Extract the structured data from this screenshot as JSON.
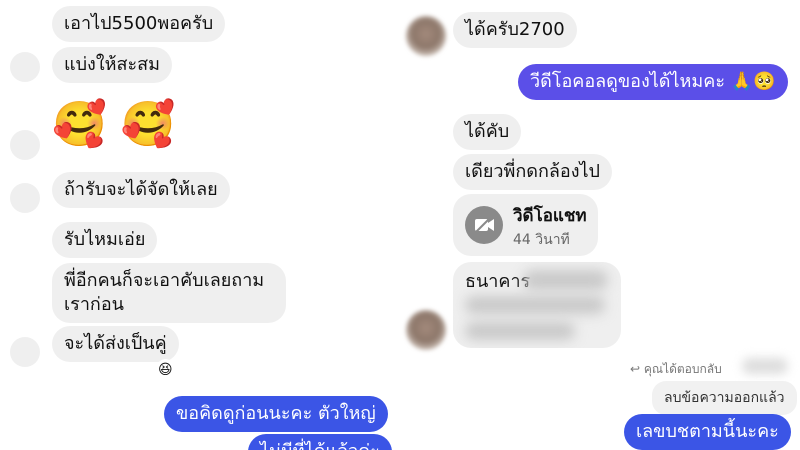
{
  "left": {
    "messages": [
      {
        "text": "เอาไป5500พอครับ"
      },
      {
        "text": "แบ่งให้สะสม"
      },
      {
        "text": "ถ้ารับจะได้จัดให้เลย"
      },
      {
        "text": "รับไหมเอ่ย"
      },
      {
        "line1": "พี่อีกคนก็จะเอาคับเลยถาม",
        "line2": "เราก่อน"
      },
      {
        "text": "จะได้ส่งเป็นคู่"
      }
    ],
    "emoji_row": "🥰 🥰",
    "reaction": "😆",
    "outgoing": [
      {
        "text": "ขอคิดดูก่อนนะคะ ตัวใหญ่"
      },
      {
        "text": "ไม่มีที่ได้แล้วค่ะ"
      }
    ]
  },
  "right": {
    "incoming_top": "ได้ครับ2700",
    "outgoing_video_call": "วีดีโอคอลดูของได้ไหมคะ 🙏🥺",
    "incoming": [
      {
        "text": "ได้คับ"
      },
      {
        "text": "เดียวพี่กดกล้องไป"
      }
    ],
    "video_chat": {
      "icon": "video-camera-icon",
      "title": "วิดีโอแชท",
      "duration": "44 วินาที"
    },
    "bank_message": "ธนาคาร",
    "reply_note": "↩ คุณได้ตอบกลับ",
    "reply_quote": "ลบข้อความออกแล้ว",
    "outgoing_reply": "เลขบชตามนี้นะคะ"
  },
  "colors": {
    "incoming_bubble": "#efefef",
    "outgoing_bubble": "#3b55e6",
    "outgoing_purple": "#5b4fe8"
  }
}
